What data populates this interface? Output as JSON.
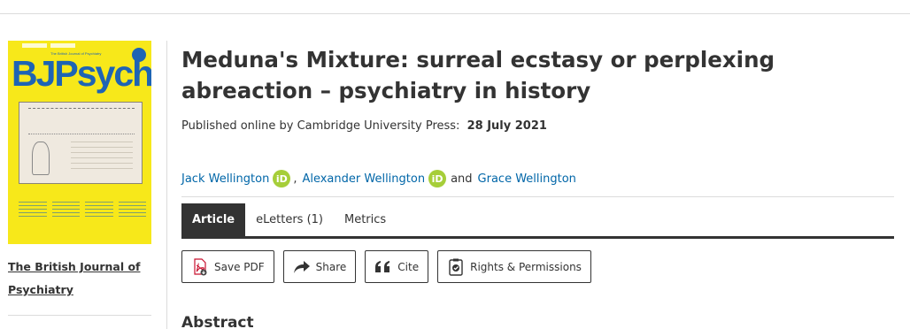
{
  "sidebar": {
    "cover_logo": "BJPsych",
    "cover_header": "The British Journal of Psychiatry",
    "journal_link": "The British Journal of Psychiatry"
  },
  "article": {
    "title": "Meduna's Mixture: surreal ecstasy or perplexing abreaction – psychiatry in history",
    "published_prefix": "Published online by Cambridge University Press:",
    "published_date": "28 July 2021",
    "authors": [
      {
        "name": "Jack Wellington",
        "orcid": "iD"
      },
      {
        "name": "Alexander Wellington",
        "orcid": "iD"
      },
      {
        "name": "Grace Wellington"
      }
    ],
    "author_separator": ",",
    "author_conjunction": "and"
  },
  "tabs": [
    {
      "label": "Article",
      "active": true
    },
    {
      "label": "eLetters (1)",
      "active": false
    },
    {
      "label": "Metrics",
      "active": false
    }
  ],
  "actions": {
    "save_pdf": "Save PDF",
    "share": "Share",
    "cite": "Cite",
    "rights": "Rights & Permissions"
  },
  "icons": {
    "save_pdf": "pdf-download-icon",
    "share": "share-arrow-icon",
    "cite": "quote-icon",
    "rights": "permissions-icon",
    "orcid": "orcid-icon"
  },
  "sections": {
    "abstract": "Abstract"
  },
  "colors": {
    "cover_yellow": "#f7e81a",
    "cover_blue": "#1e64b4",
    "link_blue": "#0066a8",
    "orcid_green": "#a6ce39",
    "active_tab": "#333333"
  }
}
